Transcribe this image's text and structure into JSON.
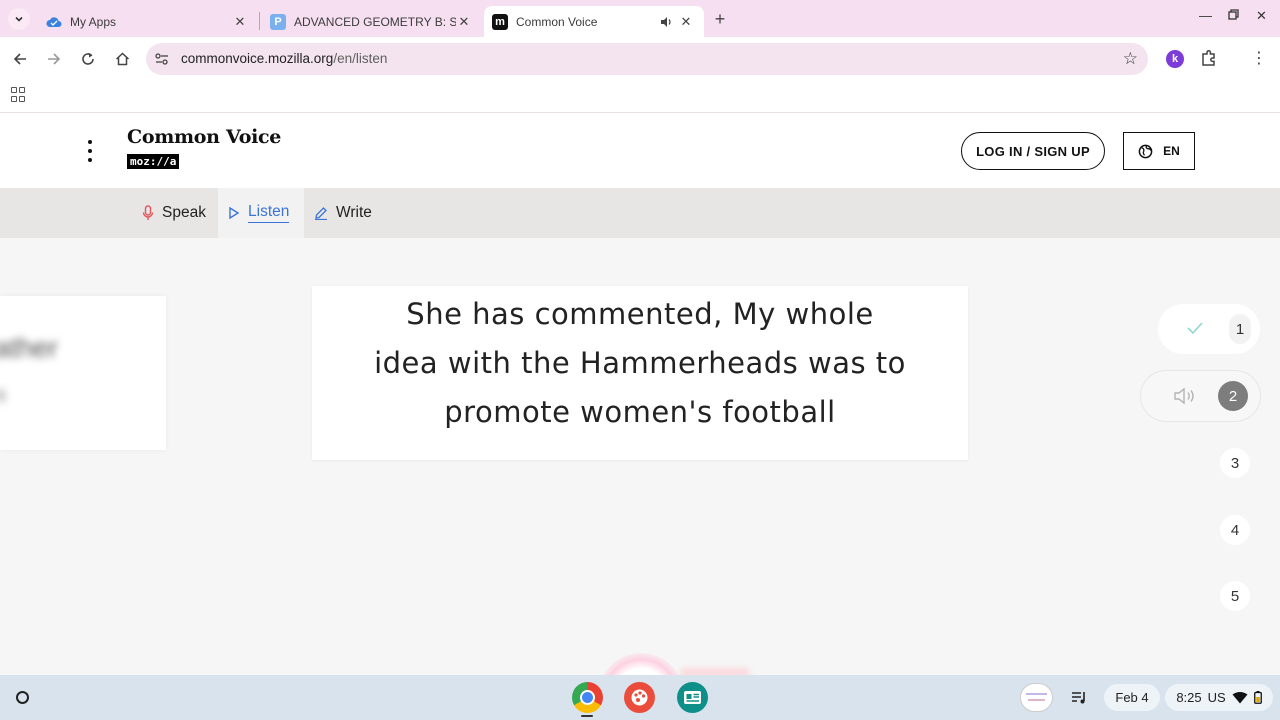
{
  "browser": {
    "tabs": [
      {
        "title": "My Apps",
        "favicon": "cloud-icon",
        "active": false
      },
      {
        "title": "ADVANCED GEOMETRY B: Sect",
        "favicon": "p-icon",
        "active": false
      },
      {
        "title": "Common Voice",
        "favicon": "m-icon",
        "active": true
      }
    ],
    "favicon_letters": {
      "p": "P",
      "m": "m"
    },
    "url_host": "commonvoice.mozilla.org",
    "url_path": "/en/listen",
    "extension_letter": "k",
    "accent": "#7d3cd9"
  },
  "site": {
    "brand_title": "Common Voice",
    "brand_sub": "moz://a",
    "login_label": "LOG IN / SIGN UP",
    "lang_label": "EN"
  },
  "subnav": {
    "speak": "Speak",
    "listen": "Listen",
    "write": "Write",
    "active_color": "#3b74d6"
  },
  "clip": {
    "sentence": "She has commented, My whole idea with the Hammerheads was to promote women's football",
    "ghost_text": "ather",
    "ghost_text2": "s"
  },
  "progress": {
    "steps": [
      "1",
      "2",
      "3",
      "4",
      "5"
    ],
    "check_color": "#5ec9c0"
  },
  "shelf": {
    "date": "Feb 4",
    "time": "8:25",
    "region": "US"
  }
}
